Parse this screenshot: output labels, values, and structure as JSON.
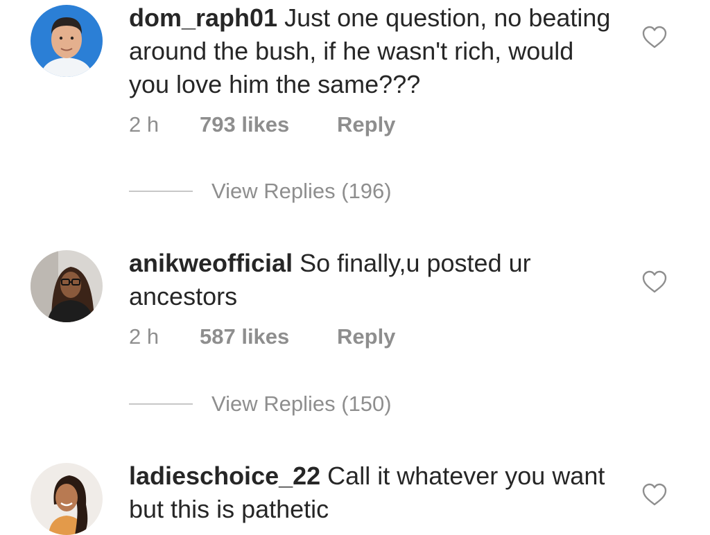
{
  "comments": [
    {
      "username": "dom_raph01",
      "text": "Just one question, no beating around the bush, if he wasn't rich, would you love him the same???",
      "time": "2 h",
      "likes": "793 likes",
      "reply_label": "Reply",
      "view_replies": "View Replies (196)",
      "avatar_colors": {
        "bg": "#2b7fd6",
        "skin": "#e4b08e",
        "hair": "#2a2320",
        "shirt": "#f2f5f8"
      }
    },
    {
      "username": "anikweofficial",
      "text": "So finally,u posted ur ancestors",
      "time": "2 h",
      "likes": "587 likes",
      "reply_label": "Reply",
      "view_replies": "View Replies (150)",
      "avatar_colors": {
        "bg": "#d9d6d2",
        "skin": "#8a5a3c",
        "hair": "#3b2418",
        "shirt": "#1d1d1d"
      }
    },
    {
      "username": "ladieschoice_22",
      "text": "Call it whatever you want but this is pathetic",
      "avatar_colors": {
        "bg": "#f0ece8",
        "skin": "#b87a52",
        "hair": "#2a1a12",
        "shirt": "#e39a4a"
      }
    }
  ],
  "icons": {
    "like": "heart-outline-icon"
  },
  "colors": {
    "text": "#262626",
    "muted": "#8e8e8e",
    "divider": "#c7c7c7",
    "heart_stroke": "#8e8e8e"
  }
}
